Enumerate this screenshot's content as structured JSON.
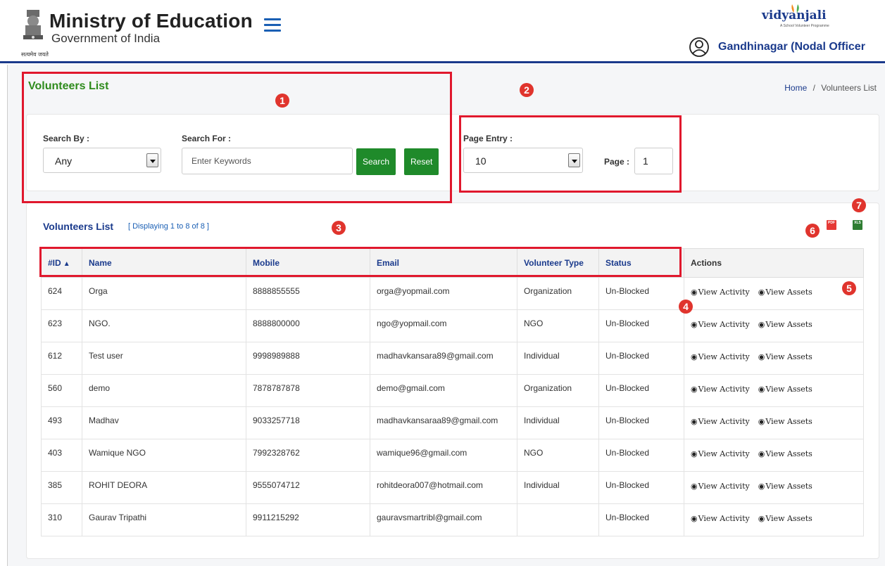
{
  "header": {
    "title": "Ministry of Education",
    "subtitle": "Government of India",
    "emblem_caption": "सत्यमेव जयते",
    "logo_text": "vidyanjali",
    "logo_tagline": "A School Volunteer Programme",
    "user_name": "Gandhinagar (Nodal Officer"
  },
  "page": {
    "title": "Volunteers List",
    "breadcrumb": {
      "home": "Home",
      "separator": "/",
      "current": "Volunteers List"
    }
  },
  "filters": {
    "search_by_label": "Search By :",
    "search_by_value": "Any",
    "search_for_label": "Search For :",
    "search_for_placeholder": "Enter Keywords",
    "search_button": "Search",
    "reset_button": "Reset",
    "page_entry_label": "Page Entry :",
    "page_entry_value": "10",
    "page_label": "Page :",
    "page_value": "1"
  },
  "list": {
    "title": "Volunteers List",
    "subtitle": "[ Displaying 1 to 8 of 8 ]",
    "pdf_label": "PDF",
    "xls_label": "XLS",
    "columns": [
      "#ID",
      "Name",
      "Mobile",
      "Email",
      "Volunteer Type",
      "Status",
      "Actions"
    ],
    "action_labels": [
      "View Activity",
      "View Assets"
    ],
    "rows": [
      {
        "id": "624",
        "name": "Orga",
        "mobile": "8888855555",
        "email": "orga@yopmail.com",
        "type": "Organization",
        "status": "Un-Blocked"
      },
      {
        "id": "623",
        "name": "NGO.",
        "mobile": "8888800000",
        "email": "ngo@yopmail.com",
        "type": "NGO",
        "status": "Un-Blocked"
      },
      {
        "id": "612",
        "name": "Test user",
        "mobile": "9998989888",
        "email": "madhavkansara89@gmail.com",
        "type": "Individual",
        "status": "Un-Blocked"
      },
      {
        "id": "560",
        "name": "demo",
        "mobile": "7878787878",
        "email": "demo@gmail.com",
        "type": "Organization",
        "status": "Un-Blocked"
      },
      {
        "id": "493",
        "name": "Madhav",
        "mobile": "9033257718",
        "email": "madhavkansaraa89@gmail.com",
        "type": "Individual",
        "status": "Un-Blocked"
      },
      {
        "id": "403",
        "name": "Wamique NGO",
        "mobile": "7992328762",
        "email": "wamique96@gmail.com",
        "type": "NGO",
        "status": "Un-Blocked"
      },
      {
        "id": "385",
        "name": "ROHIT DEORA",
        "mobile": "9555074712",
        "email": "rohitdeora007@hotmail.com",
        "type": "Individual",
        "status": "Un-Blocked"
      },
      {
        "id": "310",
        "name": "Gaurav Tripathi",
        "mobile": "9911215292",
        "email": "gauravsmartribl@gmail.com",
        "type": "",
        "status": "Un-Blocked"
      }
    ]
  },
  "annotations": [
    "1",
    "2",
    "3",
    "4",
    "5",
    "6",
    "7"
  ],
  "colors": {
    "brand_blue": "#1a3a8c",
    "accent_green": "#1f8a2a",
    "annotation_red": "#e0182d"
  }
}
